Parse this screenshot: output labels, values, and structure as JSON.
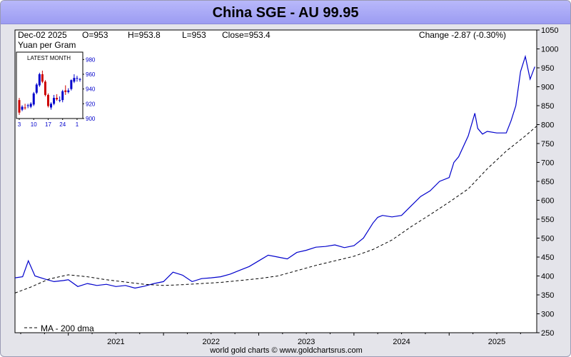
{
  "title": "China SGE - AU 99.95",
  "footer": "world gold charts © www.goldchartsrus.com",
  "header": {
    "date": "Dec-02  2025",
    "open": "O=953",
    "high": "H=953.8",
    "low": "L=953",
    "close": "Close=953.4",
    "change": "Change -2.87 (-0.30%)",
    "units": "Yuan per Gram"
  },
  "legend": {
    "ma_label": "MA - 200 dma"
  },
  "colors": {
    "price": "#0000cc",
    "ma": "#000000",
    "up": "#0000cc",
    "down": "#cc0000",
    "inset_text": "#0000cc"
  },
  "chart_data": [
    {
      "type": "line",
      "title": "China SGE - AU 99.95",
      "ylabel": "Yuan per Gram",
      "x_ticks": [
        "2021",
        "2022",
        "2023",
        "2024",
        "2025"
      ],
      "y_ticks": [
        250,
        300,
        350,
        400,
        450,
        500,
        550,
        600,
        650,
        700,
        750,
        800,
        850,
        900,
        950,
        1000,
        1050
      ],
      "ylim": [
        250,
        1050
      ],
      "xlim": [
        2020.44,
        2025.92
      ],
      "grid": false,
      "legend_position": "bottom-left",
      "series": [
        {
          "name": "AU 99.95",
          "style": "solid",
          "x": [
            2020.44,
            2020.52,
            2020.58,
            2020.65,
            2020.75,
            2020.85,
            2020.95,
            2021.0,
            2021.1,
            2021.2,
            2021.3,
            2021.4,
            2021.5,
            2021.6,
            2021.7,
            2021.8,
            2021.9,
            2022.0,
            2022.1,
            2022.2,
            2022.3,
            2022.4,
            2022.5,
            2022.6,
            2022.7,
            2022.8,
            2022.9,
            2023.0,
            2023.1,
            2023.2,
            2023.3,
            2023.4,
            2023.5,
            2023.6,
            2023.7,
            2023.8,
            2023.9,
            2024.0,
            2024.1,
            2024.2,
            2024.25,
            2024.3,
            2024.4,
            2024.5,
            2024.6,
            2024.7,
            2024.8,
            2024.9,
            2025.0,
            2025.05,
            2025.1,
            2025.2,
            2025.27,
            2025.3,
            2025.35,
            2025.4,
            2025.5,
            2025.6,
            2025.65,
            2025.7,
            2025.75,
            2025.8,
            2025.85,
            2025.9
          ],
          "y": [
            395,
            398,
            440,
            400,
            392,
            385,
            388,
            390,
            372,
            380,
            375,
            378,
            372,
            375,
            368,
            373,
            380,
            385,
            410,
            402,
            385,
            393,
            395,
            398,
            405,
            415,
            425,
            440,
            455,
            450,
            445,
            462,
            468,
            476,
            478,
            482,
            475,
            480,
            500,
            540,
            555,
            560,
            556,
            560,
            585,
            610,
            625,
            650,
            660,
            700,
            715,
            770,
            830,
            790,
            775,
            782,
            778,
            778,
            810,
            850,
            940,
            980,
            920,
            953
          ]
        },
        {
          "name": "MA - 200 dma",
          "style": "dashed",
          "x": [
            2020.44,
            2020.6,
            2020.8,
            2021.0,
            2021.2,
            2021.4,
            2021.6,
            2021.8,
            2022.0,
            2022.2,
            2022.4,
            2022.6,
            2022.8,
            2023.0,
            2023.2,
            2023.4,
            2023.6,
            2023.8,
            2024.0,
            2024.2,
            2024.4,
            2024.6,
            2024.8,
            2025.0,
            2025.2,
            2025.4,
            2025.6,
            2025.8,
            2025.92
          ],
          "y": [
            355,
            370,
            392,
            403,
            398,
            390,
            384,
            378,
            375,
            377,
            380,
            383,
            388,
            393,
            400,
            414,
            428,
            440,
            452,
            470,
            495,
            530,
            562,
            595,
            630,
            683,
            730,
            770,
            796
          ]
        }
      ]
    },
    {
      "type": "candlestick",
      "title": "LATEST MONTH",
      "x_ticks": [
        "3",
        "10",
        "17",
        "24",
        "1"
      ],
      "y_ticks": [
        900,
        920,
        940,
        960,
        980
      ],
      "ylim": [
        900,
        990
      ],
      "grid": false,
      "days": [
        3,
        4,
        5,
        6,
        7,
        10,
        11,
        12,
        13,
        14,
        17,
        18,
        19,
        20,
        21,
        24,
        25,
        26,
        27,
        28,
        1,
        2
      ],
      "open": [
        925,
        912,
        915,
        917,
        916,
        919,
        935,
        945,
        960,
        950,
        932,
        915,
        920,
        928,
        925,
        925,
        938,
        936,
        940,
        950,
        955,
        953
      ],
      "high": [
        928,
        918,
        920,
        920,
        922,
        936,
        948,
        962,
        965,
        952,
        934,
        922,
        932,
        933,
        930,
        939,
        945,
        941,
        953,
        960,
        958,
        955
      ],
      "low": [
        905,
        910,
        912,
        914,
        914,
        917,
        933,
        943,
        948,
        930,
        915,
        912,
        918,
        924,
        922,
        922,
        932,
        934,
        938,
        948,
        950,
        950
      ],
      "close": [
        908,
        916,
        914,
        918,
        920,
        934,
        946,
        960,
        950,
        932,
        917,
        920,
        928,
        926,
        925,
        937,
        936,
        938,
        952,
        955,
        955,
        953.4
      ]
    }
  ]
}
